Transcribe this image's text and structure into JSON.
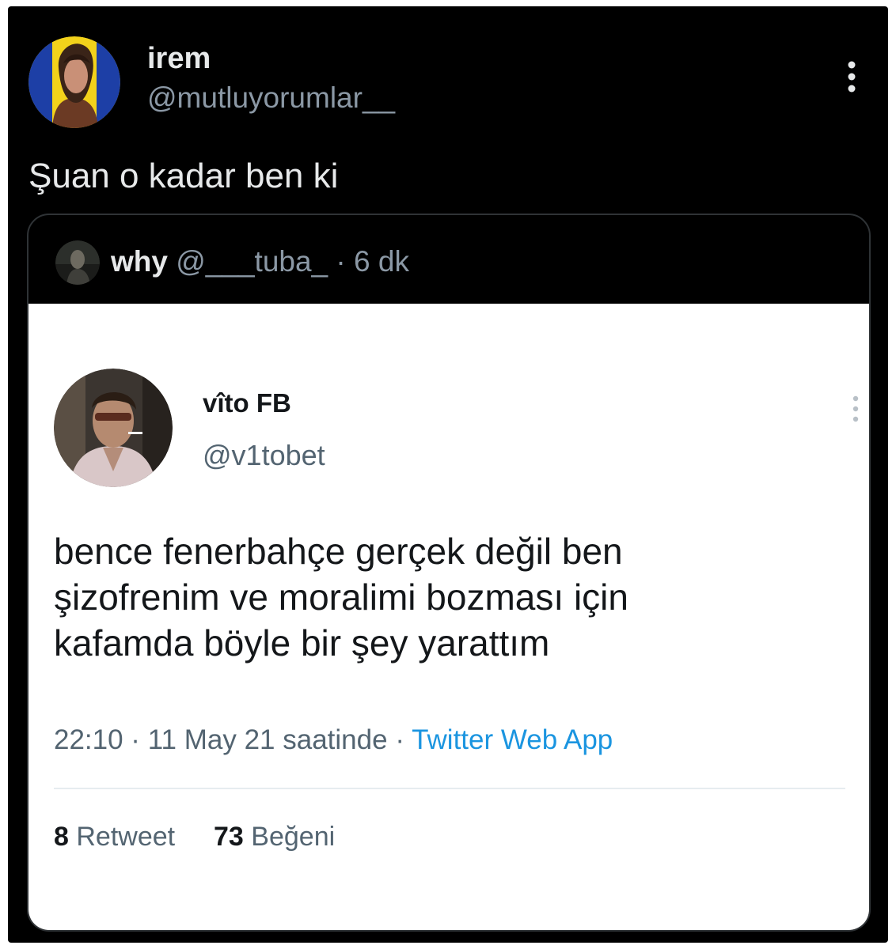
{
  "tweet": {
    "author": {
      "display_name": "irem",
      "handle": "@mutluyorumlar__",
      "avatar_icon": "profile-photo"
    },
    "more_icon": "vertical-ellipsis-icon",
    "text": "Şuan o kadar ben ki"
  },
  "quote": {
    "author": {
      "display_name": "why",
      "handle": "@___tuba_",
      "avatar_icon": "profile-photo"
    },
    "separator": "·",
    "time": "6 dk",
    "embedded_screenshot": {
      "author": {
        "display_name": "vîto FB",
        "handle": "@v1tobet",
        "avatar_icon": "profile-photo"
      },
      "more_icon": "vertical-ellipsis-icon",
      "text_lines": [
        "bence fenerbahçe gerçek değil ben",
        "şizofrenim ve moralimi bozması için",
        "kafamda böyle bir şey yarattım"
      ],
      "timestamp": "22:10 · 11 May 21 saatinde",
      "separator": "·",
      "source": "Twitter Web App",
      "stats": {
        "retweets_count": "8",
        "retweets_label": "Retweet",
        "likes_count": "73",
        "likes_label": "Beğeni"
      }
    }
  },
  "colors": {
    "background": "#000000",
    "primary_text": "#e7e9ea",
    "secondary_text": "#8b98a5",
    "link": "#1b95e0"
  }
}
